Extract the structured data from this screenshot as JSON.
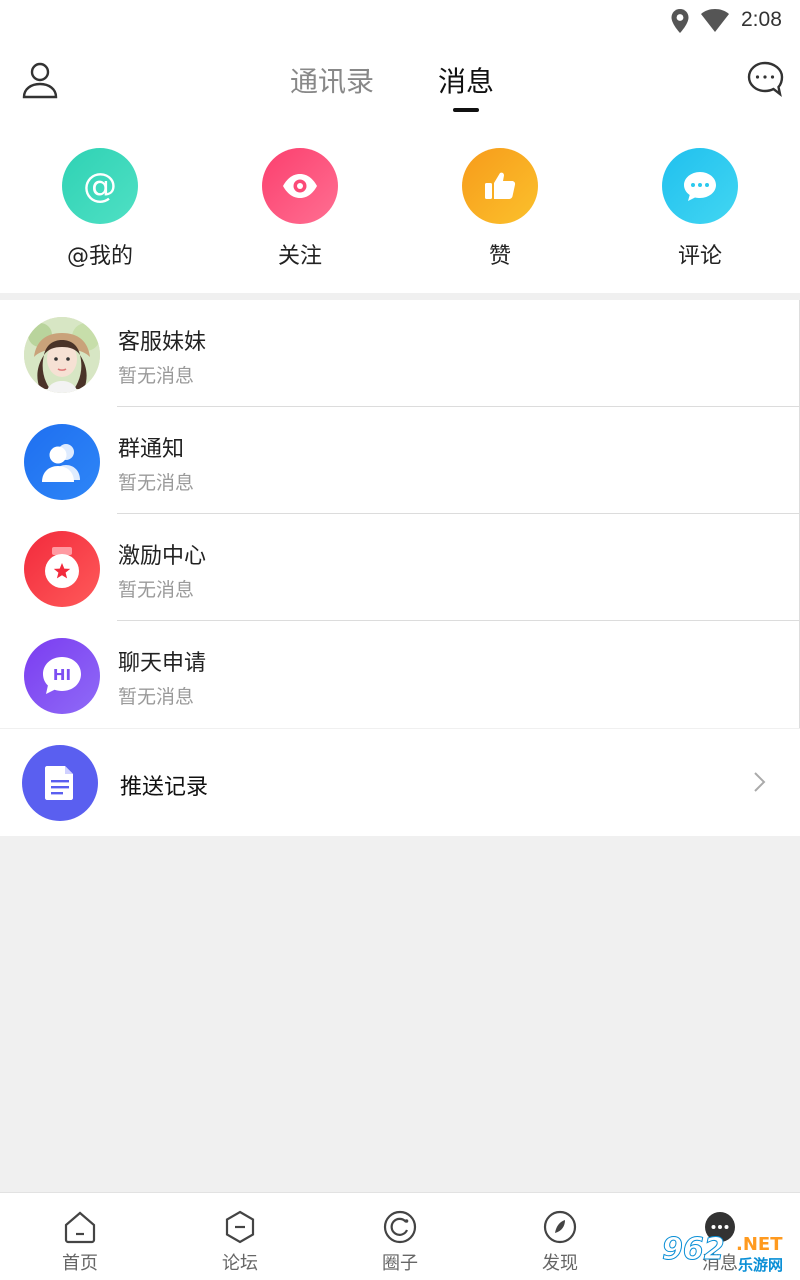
{
  "status_bar": {
    "time": "2:08"
  },
  "header": {
    "tabs": [
      {
        "label": "通讯录",
        "active": false
      },
      {
        "label": "消息",
        "active": true
      }
    ]
  },
  "quick_actions": [
    {
      "label": "@我的",
      "icon": "at-icon",
      "color": "#2fd2b4"
    },
    {
      "label": "关注",
      "icon": "eye-icon",
      "color": "#f94b79"
    },
    {
      "label": "赞",
      "icon": "thumbs-up-icon",
      "color": "#f8ac21"
    },
    {
      "label": "评论",
      "icon": "comment-icon",
      "color": "#2bc9ee"
    }
  ],
  "messages": [
    {
      "title": "客服妹妹",
      "subtitle": "暂无消息",
      "icon": "avatar-photo"
    },
    {
      "title": "群通知",
      "subtitle": "暂无消息",
      "icon": "group-icon"
    },
    {
      "title": "激励中心",
      "subtitle": "暂无消息",
      "icon": "medal-icon"
    },
    {
      "title": "聊天申请",
      "subtitle": "暂无消息",
      "icon": "hi-chat-icon"
    }
  ],
  "push_record": {
    "title": "推送记录",
    "icon": "document-icon"
  },
  "bottom_nav": [
    {
      "label": "首页",
      "icon": "home-icon"
    },
    {
      "label": "论坛",
      "icon": "forum-icon"
    },
    {
      "label": "圈子",
      "icon": "circle-icon"
    },
    {
      "label": "发现",
      "icon": "discover-icon"
    },
    {
      "label": "消息",
      "icon": "message-icon",
      "active": true
    }
  ],
  "watermark": {
    "number": "962",
    "net": ".NET",
    "site": "乐游网"
  }
}
